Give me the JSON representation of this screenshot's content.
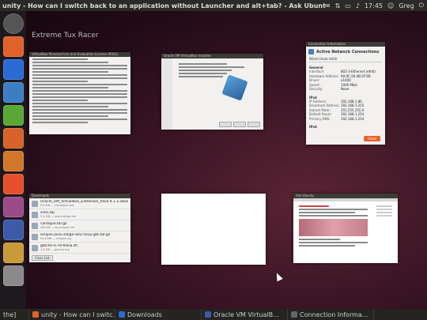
{
  "topbar": {
    "title": "unity - How can I switch back to an application without Launcher and alt+tab? - Ask Ubuntu - Stack Exchange",
    "time": "17:45",
    "user": "Greg",
    "icons": [
      "mail-icon",
      "wifi-icon",
      "battery-icon",
      "volume-icon",
      "power-icon"
    ]
  },
  "background_title": "Extreme Tux Racer",
  "launcher": {
    "items": [
      {
        "name": "dash-icon",
        "color": "#555555"
      },
      {
        "name": "files-icon",
        "color": "#e0622a"
      },
      {
        "name": "firefox-icon",
        "color": "#2a6ad4"
      },
      {
        "name": "writer-icon",
        "color": "#3d7ec2"
      },
      {
        "name": "calc-icon",
        "color": "#5aa636"
      },
      {
        "name": "impress-icon",
        "color": "#d9622a"
      },
      {
        "name": "software-center-icon",
        "color": "#d4762a"
      },
      {
        "name": "ubuntu-one-icon",
        "color": "#e5502a"
      },
      {
        "name": "settings-icon",
        "color": "#9b4a8a"
      },
      {
        "name": "virtualbox-icon",
        "color": "#3c5aa8"
      },
      {
        "name": "archive-icon",
        "color": "#c89a3a"
      },
      {
        "name": "trash-icon",
        "color": "#8a8a8a"
      }
    ]
  },
  "windows": {
    "license": {
      "title": "VirtualBox Personal Use and Evaluation License (PUEL)"
    },
    "installer": {
      "title": "Oracle VM VirtualBox Installer"
    },
    "browser": {
      "title": "Ask Ubuntu"
    }
  },
  "network": {
    "window_title": "Connection Information",
    "heading": "Active Network Connections",
    "tab": "Wired (Auto eth0)",
    "general_label": "General",
    "general": [
      {
        "k": "Interface:",
        "v": "802-3-Ethernet (eth0)"
      },
      {
        "k": "Hardware Address:",
        "v": "00:0C:29:4B:2F:9D"
      },
      {
        "k": "Driver:",
        "v": "e1000"
      },
      {
        "k": "Speed:",
        "v": "1000 Mb/s"
      },
      {
        "k": "Security:",
        "v": "None"
      }
    ],
    "ipv4_label": "IPv4",
    "ipv4": [
      {
        "k": "IP Address:",
        "v": "192.168.1.80"
      },
      {
        "k": "Broadcast Address:",
        "v": "192.168.1.255"
      },
      {
        "k": "Subnet Mask:",
        "v": "255.255.255.0"
      },
      {
        "k": "Default Route:",
        "v": "192.168.1.254"
      },
      {
        "k": "Primary DNS:",
        "v": "192.168.1.254"
      }
    ],
    "ipv6_label": "IPv6",
    "close_label": "Close"
  },
  "downloads": {
    "window_title": "Downloads",
    "items": [
      {
        "name": "Oracle_VM_VirtualBox_Extension_Pack-4.1.2.vbox-extpack",
        "sub": "9.9 MB — virtualbox.org"
      },
      {
        "name": "slick.zip",
        "sub": "5.4 MB — sourceforge.net"
      },
      {
        "name": "cardapio.tar.gz",
        "sub": "286 KB — launchpad.net"
      },
      {
        "name": "eclipse-java-indigo-SR2-linux-gtk.tar.gz",
        "sub": "95.6 MB — eclipse.org"
      },
      {
        "name": "glitche-0.79-filesa.zh",
        "sub": "1.8 MB — gnome.org"
      }
    ],
    "clear_label": "Clear List"
  },
  "taskbar": {
    "items": [
      {
        "label": "unity - How can I switc...",
        "color": "#e0622a"
      },
      {
        "label": "Downloads",
        "color": "#2a6ad4"
      },
      {
        "label": "Oracle VM VirtualB...",
        "color": "#3c5aa8"
      },
      {
        "label": "Connection Informa...",
        "color": "#666666"
      }
    ]
  }
}
